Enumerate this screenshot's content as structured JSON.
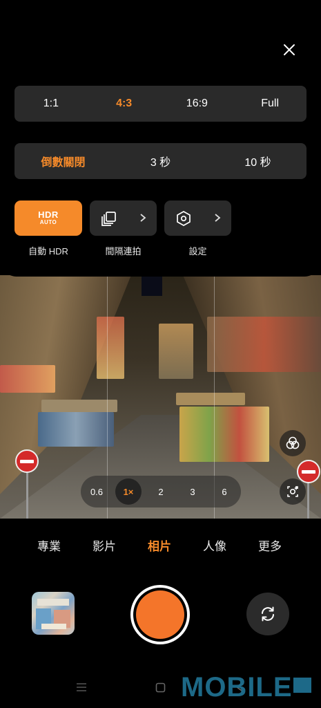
{
  "top_sheet": {
    "aspect_ratios": [
      "1:1",
      "4:3",
      "16:9",
      "Full"
    ],
    "aspect_selected": "4:3",
    "timers": [
      "倒數關閉",
      "3 秒",
      "10 秒"
    ],
    "timer_selected": "倒數關閉",
    "hdr": {
      "top": "HDR",
      "bottom": "AUTO",
      "label": "自動 HDR"
    },
    "interval_label": "間隔連拍",
    "settings_label": "設定"
  },
  "zoom": {
    "levels": [
      "0.6",
      "1×",
      "2",
      "3",
      "6"
    ],
    "selected": "1×"
  },
  "modes": {
    "items": [
      "專業",
      "影片",
      "相片",
      "人像",
      "更多"
    ],
    "selected": "相片"
  },
  "watermark": "MOBILE",
  "colors": {
    "accent": "#f58a2a",
    "shutter": "#f4752a",
    "panel": "#2a2a2a"
  },
  "icons": {
    "close": "close-icon",
    "gallery": "gallery-thumbnail",
    "flip": "camera-flip-icon",
    "filters": "filters-icon",
    "ai": "ai-scene-icon",
    "burst": "burst-stack-icon",
    "settings": "hexagon-gear-icon"
  }
}
